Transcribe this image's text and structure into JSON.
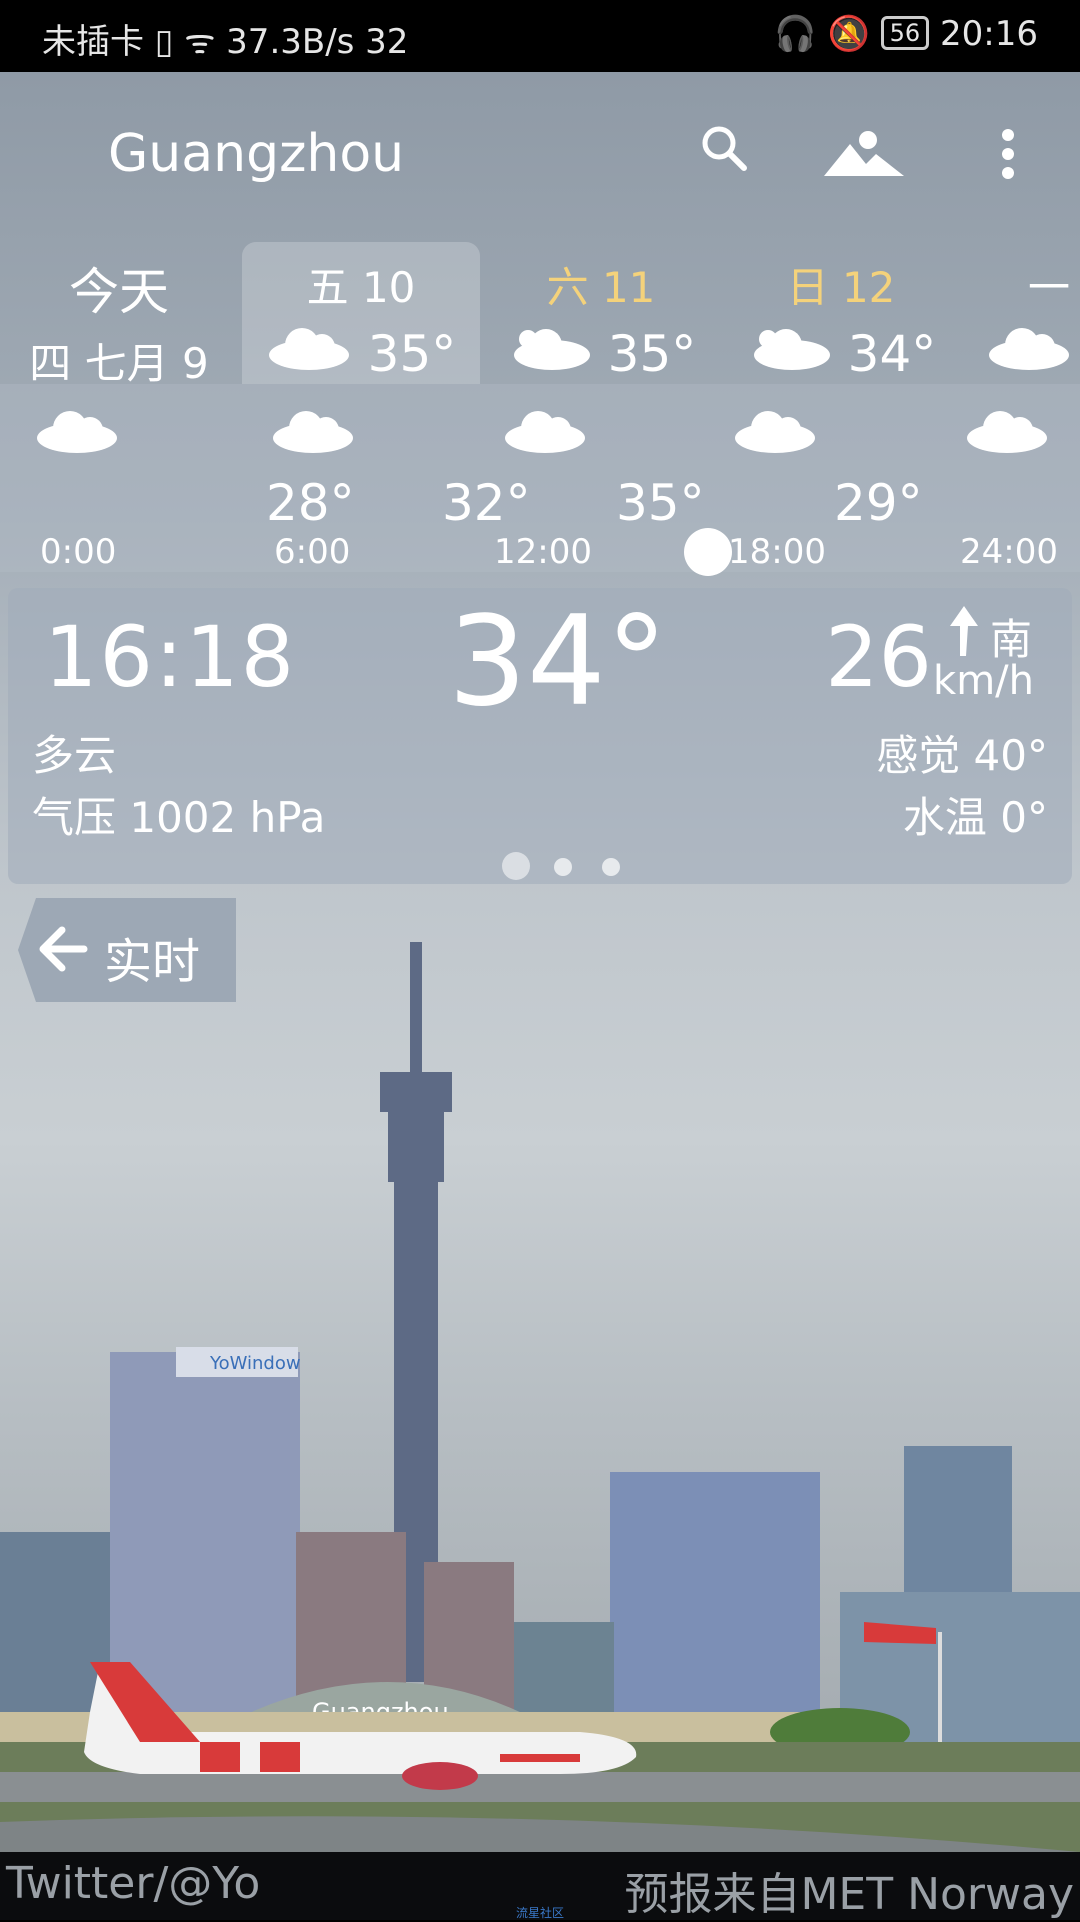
{
  "status_bar": {
    "left": "未插卡 ▯ ᯤ 37.3B/s 32",
    "battery": "56",
    "time": "20:16"
  },
  "header": {
    "city": "Guangzhou",
    "icons": [
      "search-icon",
      "landscape-icon",
      "more-vert-icon"
    ]
  },
  "days": [
    {
      "name": "今天",
      "sub": "四 七月 9"
    },
    {
      "name": "五 10",
      "temp": "35°",
      "selected": true
    },
    {
      "name": "六 11",
      "temp": "35°",
      "weekend": true
    },
    {
      "name": "日 12",
      "temp": "34°",
      "weekend": true
    },
    {
      "name": "一"
    }
  ],
  "hourly": {
    "times": [
      "0:00",
      "6:00",
      "12:00",
      "18:00",
      "24:00"
    ],
    "temps": [
      "28°",
      "32°",
      "35°",
      "29°"
    ]
  },
  "current": {
    "time": "16:18",
    "temp": "34°",
    "wind_speed": "26",
    "wind_dir": "南",
    "wind_unit": "km/h",
    "condition": "多云",
    "feels_like": "感觉 40°",
    "pressure": "气压 1002 hPa",
    "water_temp": "水温 0°"
  },
  "realtime_tab": {
    "label": "实时"
  },
  "scene": {
    "billboard": "YoWindow",
    "terminal": "Guangzhou"
  },
  "footer": {
    "left": "Twitter/@Yo",
    "right": "预报来自MET Norway",
    "center": "流星社区"
  },
  "colors": {
    "weekend": "#f4d27b",
    "plane_red": "#d83a3a"
  }
}
